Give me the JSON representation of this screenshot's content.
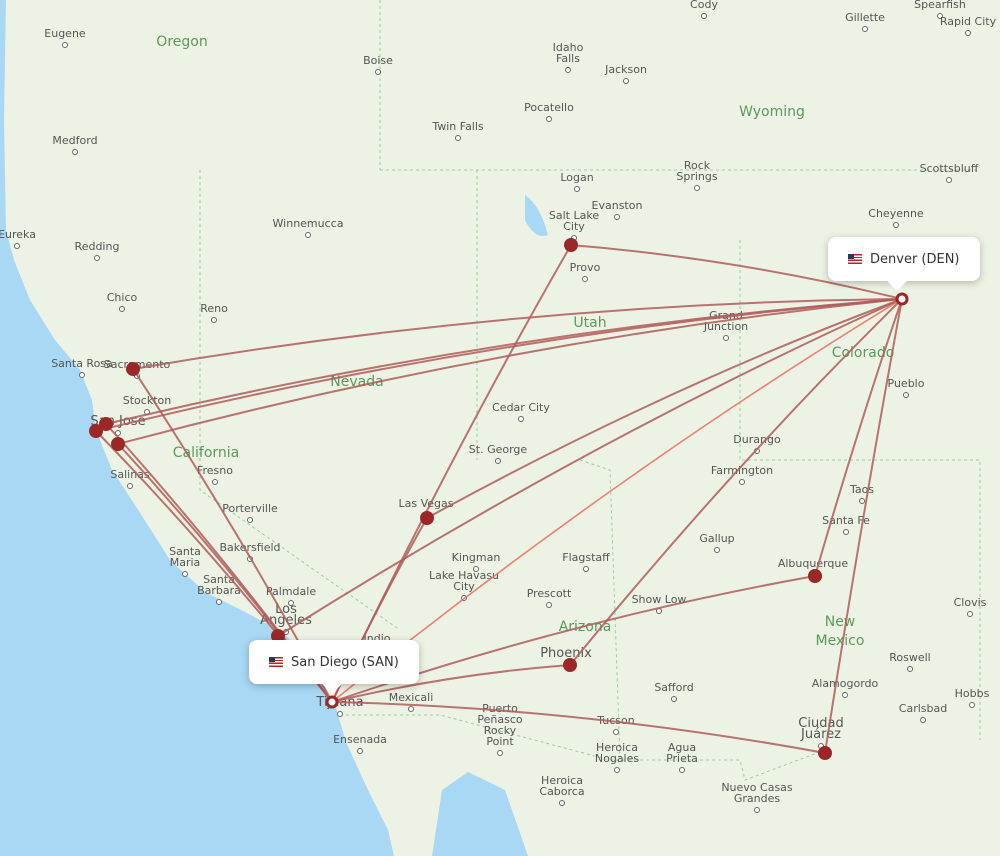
{
  "colors": {
    "land": "#edf3e4",
    "water": "#a8d8f4",
    "route": "#b05a5a",
    "highlight": "#f06a5a",
    "marker": "#9b2727"
  },
  "origin": {
    "label": "San Diego (SAN)",
    "flag": "us-flag-icon"
  },
  "destination": {
    "label": "Denver (DEN)",
    "flag": "us-flag-icon"
  },
  "states": [
    "Oregon",
    "Wyoming",
    "Utah",
    "Nevada",
    "Colorado",
    "California",
    "Arizona",
    "New Mexico"
  ],
  "cities": [
    "Eugene",
    "Boise",
    "Idaho Falls",
    "Jackson",
    "Cody",
    "Gillette",
    "Spearfish",
    "Rapid City",
    "Medford",
    "Pocatello",
    "Twin Falls",
    "Logan",
    "Rock Springs",
    "Scottsbluff",
    "Evanston",
    "Cheyenne",
    "Eureka",
    "Redding",
    "Winnemucca",
    "Salt Lake City",
    "Provo",
    "Chico",
    "Reno",
    "Grand Junction",
    "Pueblo",
    "Santa Rosa",
    "Sacramento",
    "Stockton",
    "San Jose",
    "Cedar City",
    "St. George",
    "Durango",
    "Farmington",
    "Salinas",
    "Fresno",
    "Porterville",
    "Las Vegas",
    "Taos",
    "Santa Fe",
    "Kingman",
    "Flagstaff",
    "Gallup",
    "Albuquerque",
    "Bakersfield",
    "Santa Maria",
    "Santa Barbara",
    "Palmdale",
    "Lake Havasu City",
    "Prescott",
    "Show Low",
    "Clovis",
    "Los Angeles",
    "Indio",
    "Phoenix",
    "Roswell",
    "Alamogordo",
    "Hobbs",
    "Tijuana",
    "Mexicali",
    "Safford",
    "Carlsbad",
    "Tucson",
    "Ensenada",
    "Puerto Peñasco Rocky Point",
    "Heroica Nogales",
    "Agua Prieta",
    "Ciudad Juárez",
    "Heroica Caborca",
    "Nuevo Casas Grandes"
  ]
}
